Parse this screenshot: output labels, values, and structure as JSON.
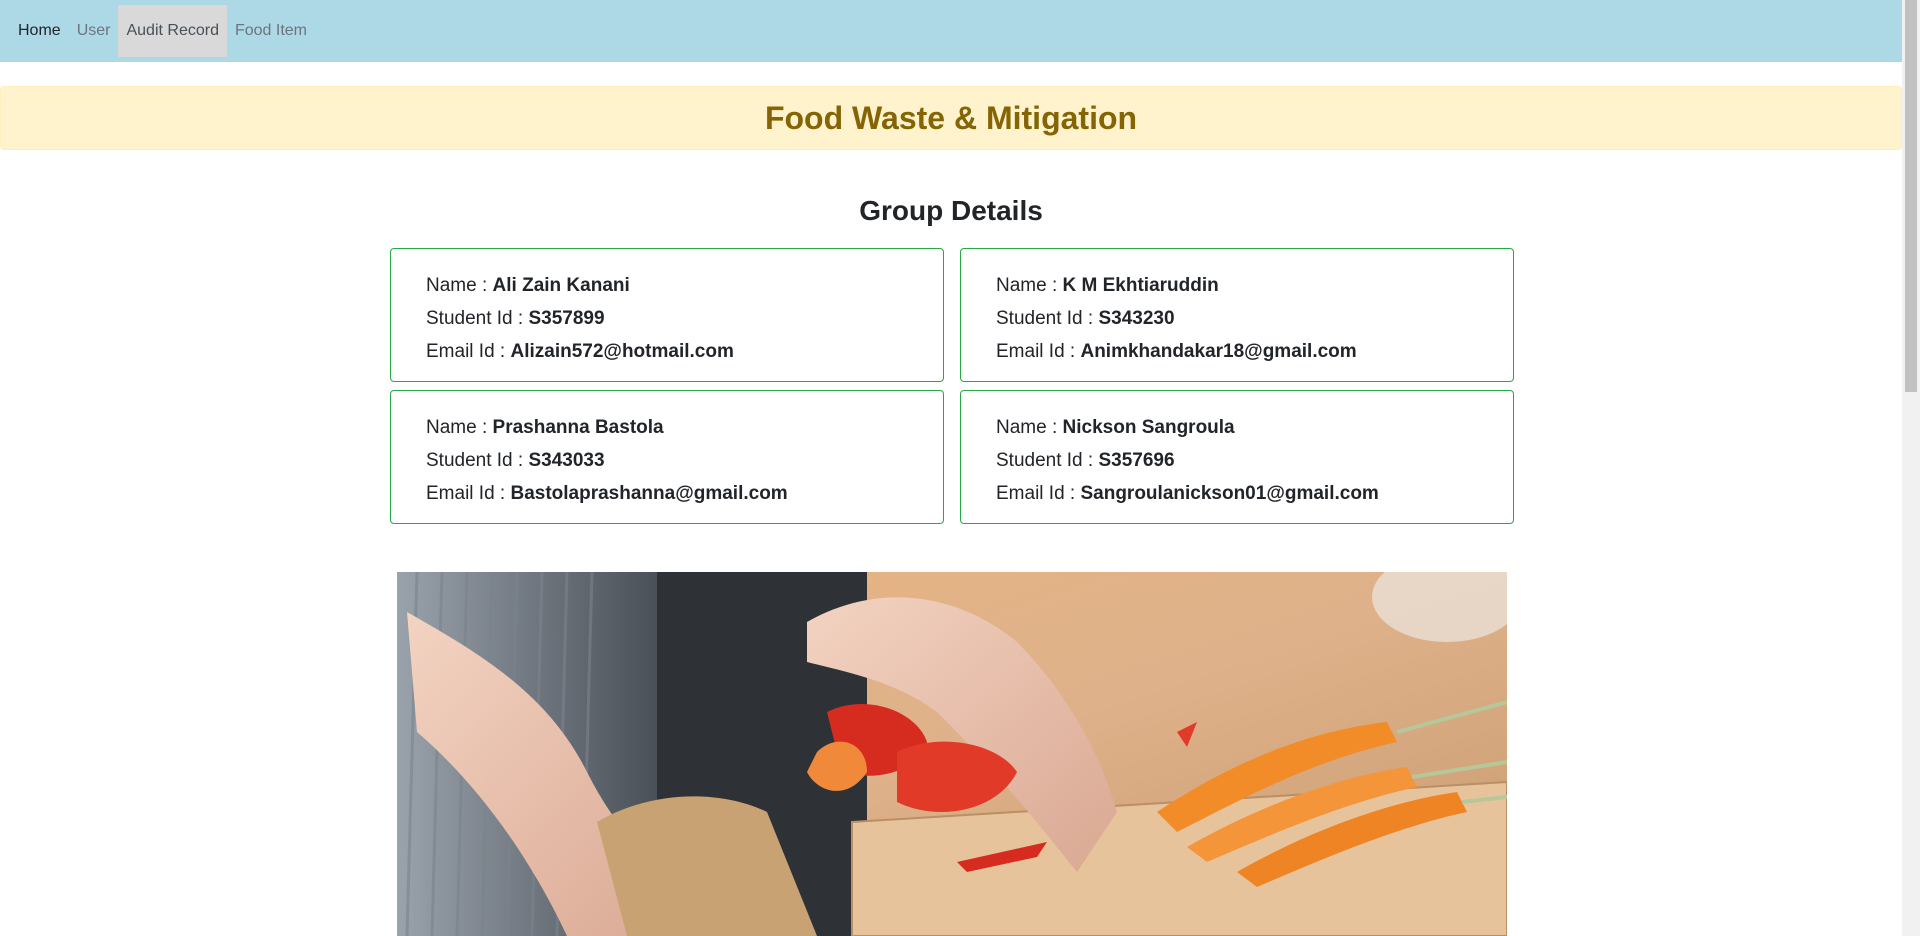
{
  "nav": {
    "items": [
      {
        "label": "Home"
      },
      {
        "label": "User"
      },
      {
        "label": "Audit Record"
      },
      {
        "label": "Food Item"
      }
    ]
  },
  "banner": {
    "title": "Food Waste & Mitigation"
  },
  "group": {
    "title": "Group Details",
    "name_label": "Name : ",
    "student_label": "Student Id : ",
    "email_label": "Email Id : ",
    "members": [
      {
        "name": "Ali Zain Kanani",
        "student_id": "S357899",
        "email": "Alizain572@hotmail.com"
      },
      {
        "name": "K M Ekhtiaruddin",
        "student_id": "S343230",
        "email": "Animkhandakar18@gmail.com"
      },
      {
        "name": "Prashanna Bastola",
        "student_id": "S343033",
        "email": "Bastolaprashanna@gmail.com"
      },
      {
        "name": "Nickson Sangroula",
        "student_id": "S357696",
        "email": "Sangroulanickson01@gmail.com"
      }
    ]
  },
  "colors": {
    "navbar": "#add8e6",
    "banner_bg": "#fff3cd",
    "banner_text": "#856404",
    "card_border": "#28a745"
  }
}
